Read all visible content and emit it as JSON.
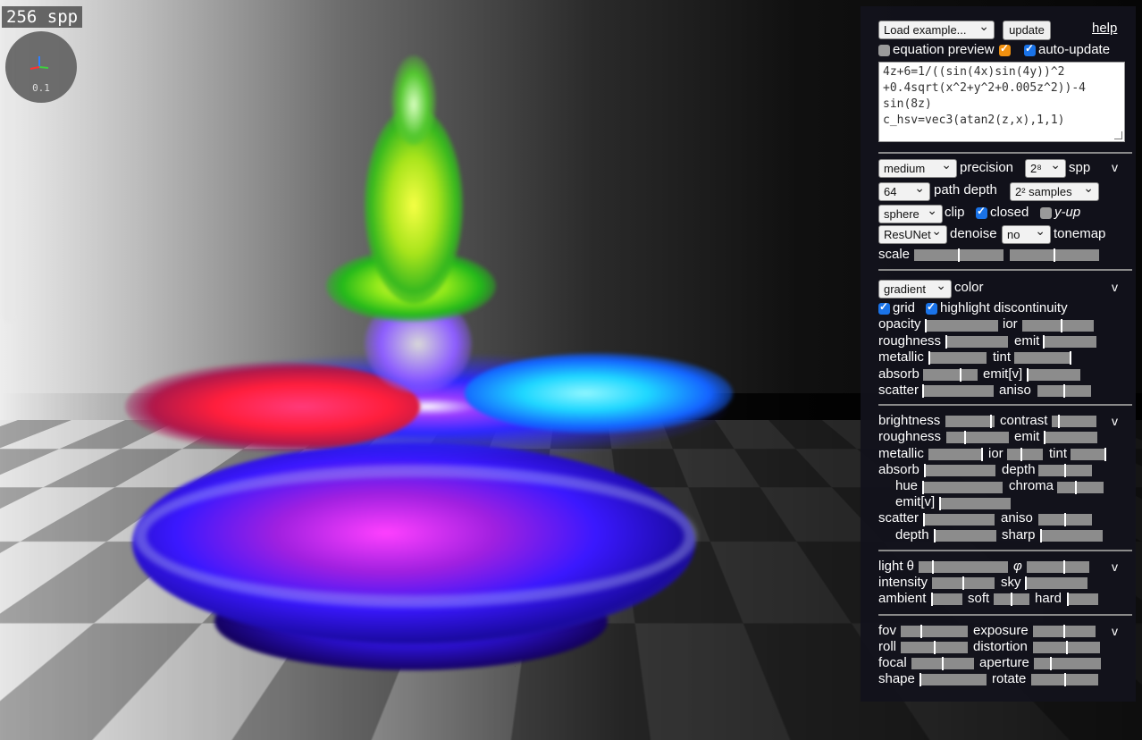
{
  "overlay": {
    "spp": "256 spp",
    "axes_scale": "0.1"
  },
  "panel": {
    "example_select": "Load example...",
    "update_button": "update",
    "help_link": "help",
    "equation_preview": {
      "label": "equation preview",
      "checked": false
    },
    "auto_update": {
      "label": "auto-update",
      "checked": true
    },
    "equation_text": "4z+6=1/((sin(4x)sin(4y))^2\n+0.4sqrt(x^2+y^2+0.005z^2))-4\nsin(8z)\nc_hsv=vec3(atan2(z,x),1,1)",
    "section_render": {
      "collapse_icon": "v",
      "precision_value": "medium",
      "precision_label": "precision",
      "spp_value": "2⁸",
      "spp_label": "spp",
      "path_depth_value": "64",
      "path_depth_label": "path depth",
      "samples_value": "2² samples",
      "clip_value": "sphere",
      "clip_label": "clip",
      "closed": {
        "label": "closed",
        "checked": true
      },
      "yup": {
        "label": "y-up",
        "checked": false
      },
      "denoise_value": "ResUNet",
      "denoise_label": "denoise",
      "tonemap_value": "no",
      "tonemap_label": "tonemap",
      "scale_label": "scale",
      "scale_slider_1": 0.5,
      "scale_slider_2": 0.5
    },
    "section_color": {
      "collapse_icon": "v",
      "color_value": "gradient",
      "color_label": "color",
      "grid": {
        "label": "grid",
        "checked": true
      },
      "highlight": {
        "label": "highlight discontinuity",
        "checked": true
      },
      "labels": {
        "opacity": "opacity",
        "ior": "ior",
        "roughness": "roughness",
        "emit": "emit",
        "metallic": "metallic",
        "tint": "tint",
        "absorb": "absorb",
        "emit_v": "emit[v]",
        "scatter": "scatter",
        "aniso": "aniso"
      },
      "values": {
        "opacity": 0.0,
        "ior": 0.55,
        "roughness": 0.0,
        "emit": 0.0,
        "metallic": 0.0,
        "tint": 1.0,
        "absorb": 0.7,
        "emit_v": 0.0,
        "scatter": 0.0,
        "aniso": 0.5
      }
    },
    "section_surface": {
      "collapse_icon": "v",
      "labels": {
        "brightness": "brightness",
        "contrast": "contrast",
        "roughness": "roughness",
        "emit": "emit",
        "metallic": "metallic",
        "ior": "ior",
        "tint": "tint",
        "absorb": "absorb",
        "depth": "depth",
        "hue": "hue",
        "chroma": "chroma",
        "emit_v": "emit[v]",
        "scatter": "scatter",
        "aniso": "aniso",
        "depth2": "depth",
        "sharp": "sharp"
      },
      "values": {
        "brightness": 0.95,
        "contrast": 0.15,
        "roughness": 0.3,
        "emit": 0.0,
        "metallic": 1.0,
        "ior": 0.4,
        "tint": 1.0,
        "absorb": 0.0,
        "depth": 0.5,
        "hue": 0.0,
        "chroma": 0.4,
        "emit_v": 0.0,
        "scatter": 0.0,
        "aniso": 0.5,
        "depth2": 0.0,
        "sharp": 0.0
      }
    },
    "section_light": {
      "collapse_icon": "v",
      "labels": {
        "theta": "light θ",
        "phi": "φ",
        "intensity": "intensity",
        "sky": "sky",
        "ambient": "ambient",
        "soft": "soft",
        "hard": "hard"
      },
      "values": {
        "theta": 0.15,
        "phi": 0.6,
        "intensity": 0.5,
        "sky": 0.0,
        "ambient": 0.0,
        "soft": 0.5,
        "hard": 0.0
      }
    },
    "section_camera": {
      "collapse_icon": "v",
      "labels": {
        "fov": "fov",
        "exposure": "exposure",
        "roll": "roll",
        "distortion": "distortion",
        "focal": "focal",
        "aperture": "aperture",
        "shape": "shape",
        "rotate": "rotate"
      },
      "values": {
        "fov": 0.3,
        "exposure": 0.5,
        "roll": 0.5,
        "distortion": 0.5,
        "focal": 0.5,
        "aperture": 0.25,
        "shape": 0.0,
        "rotate": 0.5
      }
    }
  }
}
